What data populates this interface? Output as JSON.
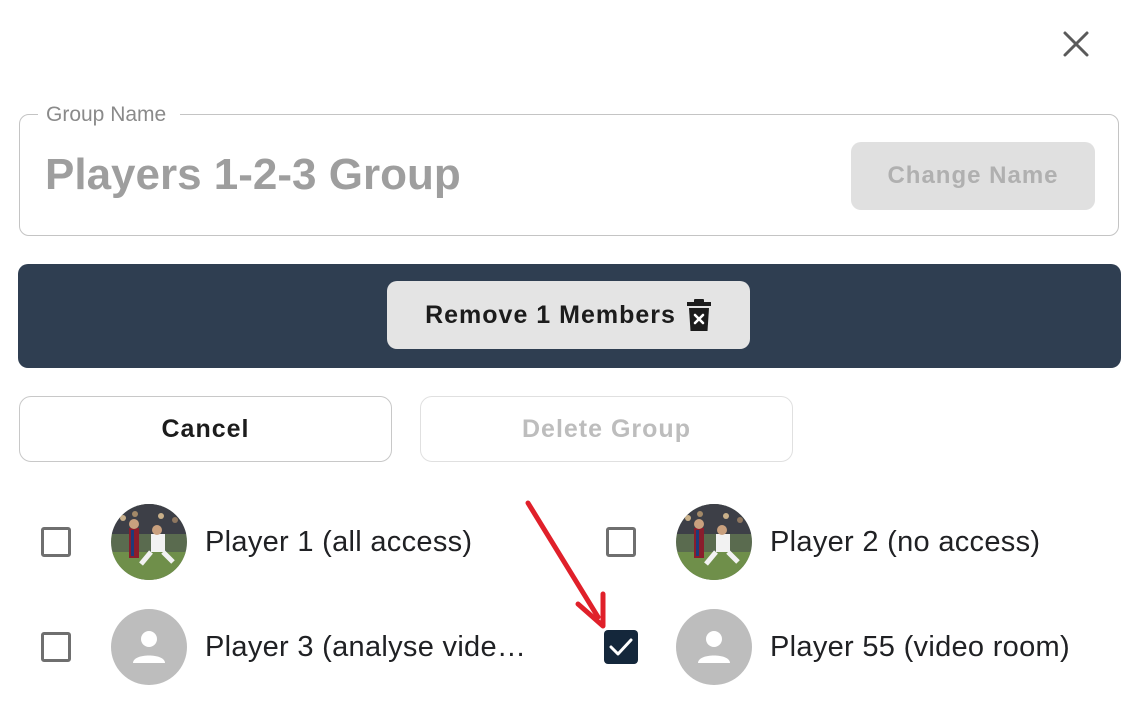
{
  "dialog": {
    "close_icon": "close-icon"
  },
  "group_name": {
    "legend": "Group Name",
    "value": "Players 1-2-3 Group",
    "change_name_label": "Change Name"
  },
  "selection_bar": {
    "remove_label": "Remove 1 Members",
    "remove_icon": "trash-icon",
    "background_color": "#2f3e51"
  },
  "actions": {
    "cancel_label": "Cancel",
    "delete_label": "Delete Group"
  },
  "members": [
    {
      "name": "Player 1 (all access)",
      "checked": false,
      "avatar": "photo"
    },
    {
      "name": "Player 2 (no access)",
      "checked": false,
      "avatar": "photo"
    },
    {
      "name": "Player 3 (analyse vide…",
      "checked": false,
      "avatar": "person-placeholder-icon"
    },
    {
      "name": "Player 55 (video room)",
      "checked": true,
      "avatar": "person-placeholder-icon"
    }
  ],
  "annotation": {
    "arrow_color": "#e0202a"
  }
}
